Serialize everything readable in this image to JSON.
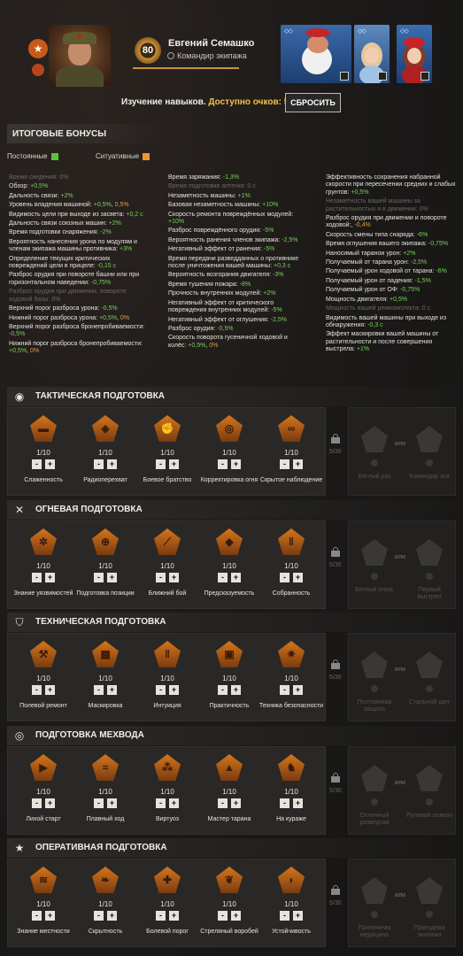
{
  "header": {
    "commander_level": "80",
    "commander_name": "Евгений Семашко",
    "commander_role": "Командир экипажа",
    "tank_markers": [
      "◇◇",
      "◇◇",
      "◇◇"
    ]
  },
  "study": {
    "label": "Изучение навыков.",
    "points_label": "Доступно очков: 55",
    "reset_label": "СБРОСИТЬ"
  },
  "bonuses": {
    "title": "ИТОГОВЫЕ БОНУСЫ",
    "legend_permanent": "Постоянные",
    "legend_situational": "Ситуативные",
    "color_permanent": "#5bc236",
    "color_situational": "#e89a2a",
    "col1": [
      {
        "t": "Время сведения: 0%",
        "dim": true
      },
      {
        "t": "Обзор:",
        "g": "+0,5%"
      },
      {
        "t": "Дальность связи:",
        "g": "+2%"
      },
      {
        "t": "Уровень владения машиной:",
        "g": "+0,5%",
        "o": "0,5%"
      },
      {
        "t": "Видимость цели при выходе из засвета:",
        "g": "+0,2 с"
      },
      {
        "t": "Дальность связи союзных машин:",
        "g": "+2%"
      },
      {
        "t": "Время подготовки снаряжения:",
        "g": "-2%"
      },
      {
        "t": "Вероятность нанесения урона по модулям и членам экипажа машины противника:",
        "g": "+3%"
      },
      {
        "t": "Определение текущих критических повреждений цели в прицеле:",
        "g": "-0,15 с"
      },
      {
        "t": "Разброс орудия при повороте башни или при горизонтальном наведении:",
        "g": "-0,75%"
      },
      {
        "t": "Разброс орудия при движении, повороте ходовой базы: 0%",
        "dim": true
      },
      {
        "t": "Верхний порог разброса урона:",
        "g": "-0,5%"
      },
      {
        "t": "Нижний порог разброса урона:",
        "g": "+0,5%",
        "o": "0%"
      },
      {
        "t": "Верхний порог разброса бронепробиваемости:",
        "g": "-0,5%"
      },
      {
        "t": "Нижний порог разброса бронепробиваемости:",
        "g": "+0,5%",
        "o": "0%"
      }
    ],
    "col2": [
      {
        "t": "Время заряжания:",
        "g": "-1,3%"
      },
      {
        "t": "Время подготовки аптечки: 0 с",
        "dim": true
      },
      {
        "t": "Незаметность машины:",
        "g": "+1%"
      },
      {
        "t": "Базовая незаметность машины:",
        "g": "+10%"
      },
      {
        "t": "Скорость ремонта повреждённых модулей:",
        "g": "+10%"
      },
      {
        "t": "Разброс повреждённого орудия:",
        "g": "-5%"
      },
      {
        "t": "Вероятность ранения членов экипажа:",
        "g": "-2,5%"
      },
      {
        "t": "Негативный эффект от ранения:",
        "g": "-5%"
      },
      {
        "t": "Время передачи разведданных о противнике после уничтожения вашей машины:",
        "g": "+0,3 с"
      },
      {
        "t": "Вероятность возгорания двигателя:",
        "g": "-3%"
      },
      {
        "t": "Время тушения пожара:",
        "g": "-8%"
      },
      {
        "t": "Прочность внутренних модулей:",
        "g": "+2%"
      },
      {
        "t": "Негативный эффект от критического повреждения внутренних модулей:",
        "g": "-5%"
      },
      {
        "t": "Негативный эффект от оглушения:",
        "g": "-2,5%"
      },
      {
        "t": "Разброс орудия:",
        "g": "-0,5%"
      },
      {
        "t": "Скорость поворота гусеничной ходовой и колёс:",
        "g": "+0,5%",
        "o": "0%"
      }
    ],
    "col3": [
      {
        "t": "Эффективность сохранения набранной скорости при пересечении средних и слабых грунтов:",
        "g": "+0,5%"
      },
      {
        "t": "Незаметность вашей машины за растительностью и в движении: 0%",
        "dim": true
      },
      {
        "t": "Разброс орудия при движении и повороте ходовой:",
        "o": "-0,4%"
      },
      {
        "t": "Скорость смены типа снаряда:",
        "g": "-6%"
      },
      {
        "t": "Время оглушения вашего экипажа:",
        "g": "-0,75%"
      },
      {
        "t": "Наносимый таранои урон:",
        "g": "+2%"
      },
      {
        "t": "Получаемый от тарана урон:",
        "g": "-2,5%"
      },
      {
        "t": "Получаемый урон ходовой от тарана:",
        "g": "-6%"
      },
      {
        "t": "Получаемый урон от падения:",
        "g": "-1,5%"
      },
      {
        "t": "Получаемый урон от ОФ:",
        "g": "-0,75%"
      },
      {
        "t": "Мощность двигателя:",
        "g": "+0,5%"
      },
      {
        "t": "Мощность вашей ремкомплекта: 0 с",
        "dim": true
      },
      {
        "t": "Видимость вашей машины при выходе из обнаружения:",
        "g": "-0,3 с"
      },
      {
        "t": "Эффект маскировки вашей машины от растительности и после совершения выстрела:",
        "g": "+1%"
      }
    ]
  },
  "sections": [
    {
      "title": "ТАКТИЧЕСКАЯ ПОДГОТОВКА",
      "icon": "eye-icon",
      "lock_text": "5/30",
      "elite_or": "или",
      "elite_names": [
        "Беглый раз",
        "Командир зна"
      ],
      "skills": [
        {
          "name": "Слаженность",
          "level": "1/10",
          "icon": "tank-icon"
        },
        {
          "name": "Радиоперехват",
          "level": "1/10",
          "icon": "radio-icon"
        },
        {
          "name": "Боевое братство",
          "level": "1/10",
          "icon": "fist-icon"
        },
        {
          "name": "Корректировка огня",
          "level": "1/10",
          "icon": "target-icon"
        },
        {
          "name": "Скрытое наблюдение",
          "level": "1/10",
          "icon": "binoculars-icon"
        }
      ]
    },
    {
      "title": "ОГНЕВАЯ ПОДГОТОВКА",
      "icon": "crossed-shells-icon",
      "lock_text": "5/30",
      "elite_or": "или",
      "elite_names": [
        "Беглый огонь",
        "Первый выстрел"
      ],
      "skills": [
        {
          "name": "Знание уязвимостей",
          "level": "1/10",
          "icon": "gear-crack-icon"
        },
        {
          "name": "Подготовка позиции",
          "level": "1/10",
          "icon": "crosshair-icon"
        },
        {
          "name": "Ближний бой",
          "level": "1/10",
          "icon": "cannon-icon"
        },
        {
          "name": "Предсказуемость",
          "level": "1/10",
          "icon": "shell-drop-icon"
        },
        {
          "name": "Собранность",
          "level": "1/10",
          "icon": "shells-icon"
        }
      ]
    },
    {
      "title": "ТЕХНИЧЕСКАЯ ПОДГОТОВКА",
      "icon": "shield-icon",
      "lock_text": "5/30",
      "elite_or": "или",
      "elite_names": [
        "Постоянная защита",
        "Стальной щит"
      ],
      "skills": [
        {
          "name": "Полевой ремонт",
          "level": "1/10",
          "icon": "wrench-icon"
        },
        {
          "name": "Маскировка",
          "level": "1/10",
          "icon": "camo-icon"
        },
        {
          "name": "Интуиция",
          "level": "1/10",
          "icon": "shells-icon"
        },
        {
          "name": "Практичность",
          "level": "1/10",
          "icon": "toolbox-icon"
        },
        {
          "name": "Техника безопасности",
          "level": "1/10",
          "icon": "safety-gear-icon"
        }
      ]
    },
    {
      "title": "ПОДГОТОВКА МЕХВОДА",
      "icon": "steering-wheel-icon",
      "lock_text": "5/30",
      "elite_or": "или",
      "elite_names": [
        "Отличный разведчик",
        "Рулевой ловкач"
      ],
      "skills": [
        {
          "name": "Лихой старт",
          "level": "1/10",
          "icon": "tank-speed-icon"
        },
        {
          "name": "Плавный ход",
          "level": "1/10",
          "icon": "tank-smooth-icon"
        },
        {
          "name": "Виртуоз",
          "level": "1/10",
          "icon": "tracks-icon"
        },
        {
          "name": "Мастер тарана",
          "level": "1/10",
          "icon": "ram-icon"
        },
        {
          "name": "На кураже",
          "level": "1/10",
          "icon": "knight-icon"
        }
      ]
    },
    {
      "title": "ОПЕРАТИВНАЯ ПОДГОТОВКА",
      "icon": "star-icon",
      "lock_text": "5/30",
      "elite_or": "или",
      "elite_names": [
        "Прилежная медицина",
        "Пригодная экипажа"
      ],
      "skills": [
        {
          "name": "Знание местности",
          "level": "1/10",
          "icon": "terrain-icon"
        },
        {
          "name": "Скрытность",
          "level": "1/10",
          "icon": "leaf-icon"
        },
        {
          "name": "Болевой порог",
          "level": "1/10",
          "icon": "first-aid-icon"
        },
        {
          "name": "Стреляный воробей",
          "level": "1/10",
          "icon": "wreath-icon"
        },
        {
          "name": "Устойчивость",
          "level": "1/10",
          "icon": "helmet-icon"
        }
      ]
    }
  ]
}
